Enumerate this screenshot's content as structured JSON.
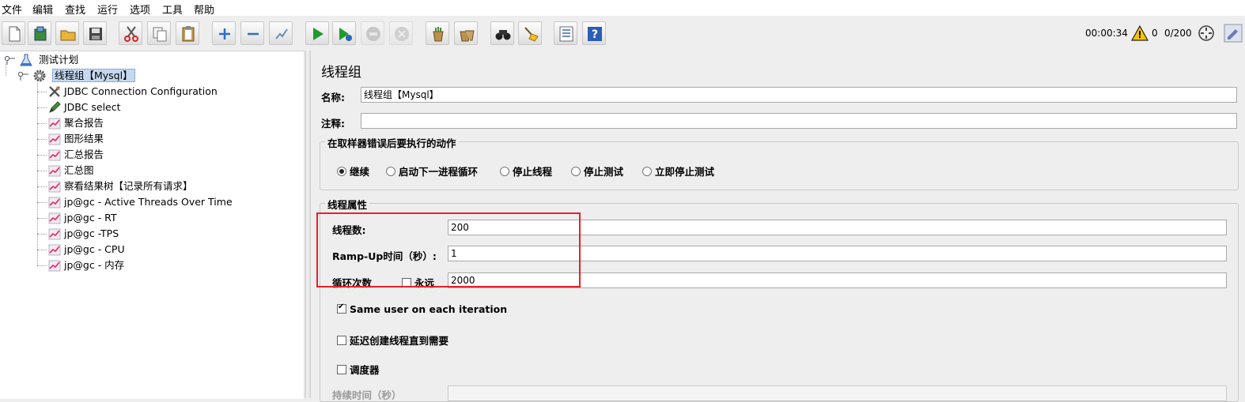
{
  "menu": [
    "文件",
    "编辑",
    "查找",
    "运行",
    "选项",
    "工具",
    "帮助"
  ],
  "toolbar": {
    "buttons": [
      {
        "name": "new-icon"
      },
      {
        "name": "templates-icon"
      },
      {
        "name": "open-icon"
      },
      {
        "name": "save-icon"
      },
      {
        "name": "cut-icon"
      },
      {
        "name": "copy-icon"
      },
      {
        "name": "paste-icon"
      },
      {
        "name": "expand-icon"
      },
      {
        "name": "collapse-icon"
      },
      {
        "name": "toggle-icon"
      },
      {
        "name": "start-icon"
      },
      {
        "name": "start-no-pauses-icon"
      },
      {
        "name": "stop-icon"
      },
      {
        "name": "shutdown-icon"
      },
      {
        "name": "clear-icon"
      },
      {
        "name": "clear-all-icon"
      },
      {
        "name": "search-icon"
      },
      {
        "name": "reset-search-icon"
      },
      {
        "name": "function-helper-icon"
      },
      {
        "name": "help-icon"
      }
    ],
    "elapsed_time": "00:00:34",
    "warning_count": "0",
    "threads": "0/200"
  },
  "tree": {
    "root": "测试计划",
    "thread_group": "线程组【Mysql】",
    "children": [
      {
        "label": "JDBC Connection Configuration",
        "icon": "config-tools-icon"
      },
      {
        "label": "JDBC select",
        "icon": "sampler-pen-icon"
      },
      {
        "label": "聚合报告",
        "icon": "listener-graph-icon"
      },
      {
        "label": "图形结果",
        "icon": "listener-graph-icon"
      },
      {
        "label": "汇总报告",
        "icon": "listener-graph-icon"
      },
      {
        "label": "汇总图",
        "icon": "listener-graph-icon"
      },
      {
        "label": "察看结果树【记录所有请求】",
        "icon": "listener-graph-icon"
      },
      {
        "label": "jp@gc - Active Threads Over Time",
        "icon": "listener-graph-icon"
      },
      {
        "label": "jp@gc - RT",
        "icon": "listener-graph-icon"
      },
      {
        "label": "jp@gc -TPS",
        "icon": "listener-graph-icon"
      },
      {
        "label": "jp@gc - CPU",
        "icon": "listener-graph-icon"
      },
      {
        "label": "jp@gc - 内存",
        "icon": "listener-graph-icon"
      }
    ]
  },
  "panel": {
    "title": "线程组",
    "name_label": "名称:",
    "name_value": "线程组【Mysql】",
    "comment_label": "注释:",
    "comment_value": "",
    "error_group_title": "在取样器错误后要执行的动作",
    "error_options": [
      {
        "label": "继续",
        "selected": true
      },
      {
        "label": "启动下一进程循环",
        "selected": false
      },
      {
        "label": "停止线程",
        "selected": false
      },
      {
        "label": "停止测试",
        "selected": false
      },
      {
        "label": "立即停止测试",
        "selected": false
      }
    ],
    "thread_group_title": "线程属性",
    "threads_label": "线程数:",
    "threads_value": "200",
    "rampup_label": "Ramp-Up时间（秒）:",
    "rampup_value": "1",
    "loop_label": "循环次数",
    "forever_label": "永远",
    "forever_checked": false,
    "loop_value": "2000",
    "same_user_label": "Same user on each iteration",
    "same_user_checked": true,
    "delay_label": "延迟创建线程直到需要",
    "delay_checked": false,
    "scheduler_label": "调度器",
    "scheduler_checked": false,
    "duration_label": "持续时间（秒）"
  },
  "colors": {
    "highlight_box": "#e8202c",
    "selection": "#c5d8f0",
    "warning": "#f5c400"
  }
}
